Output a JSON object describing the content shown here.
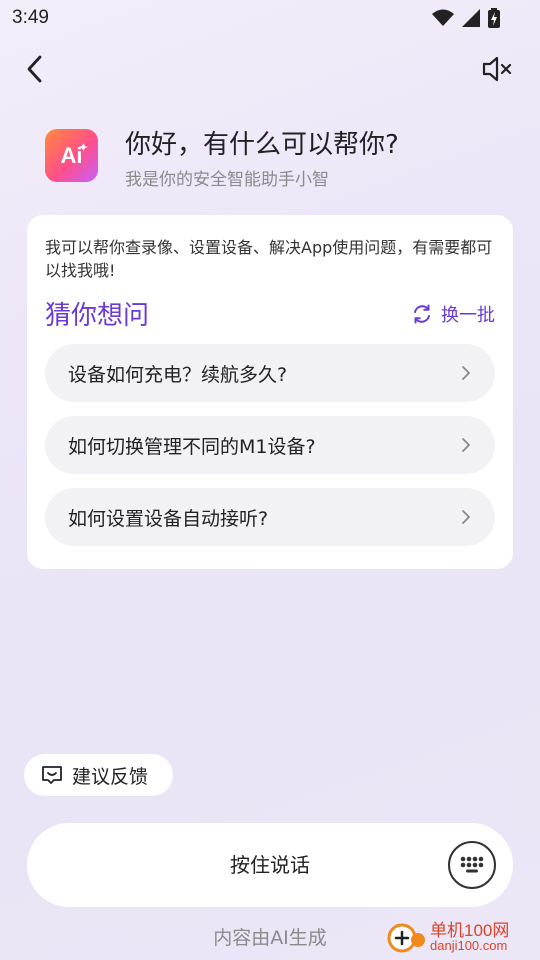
{
  "status_bar": {
    "time": "3:49",
    "icons": [
      "wifi-icon",
      "signal-icon",
      "battery-charging-icon"
    ]
  },
  "nav": {
    "back_icon": "chevron-left-icon",
    "mute_icon": "speaker-mute-icon"
  },
  "header": {
    "logo_text": "Ai",
    "title": "你好，有什么可以帮你?",
    "subtitle": "我是你的安全智能助手小智"
  },
  "card": {
    "intro": "我可以帮你查录像、设置设备、解决App使用问题，有需要都可以找我哦!",
    "guess_title": "猜你想问",
    "refresh_label": "换一批",
    "questions": [
      {
        "text": "设备如何充电？续航多久?"
      },
      {
        "text": "如何切换管理不同的M1设备?"
      },
      {
        "text": "如何设置设备自动接听?"
      }
    ]
  },
  "feedback": {
    "label": "建议反馈"
  },
  "voice": {
    "label": "按住说话",
    "keyboard_icon": "keypad-icon"
  },
  "footer": {
    "note": "内容由AI生成"
  },
  "watermark": {
    "title": "单机100网",
    "url": "danji100.com"
  },
  "colors": {
    "accent": "#6a3bd6",
    "card_bg": "#ffffff",
    "question_bg": "#f2f2f5"
  }
}
